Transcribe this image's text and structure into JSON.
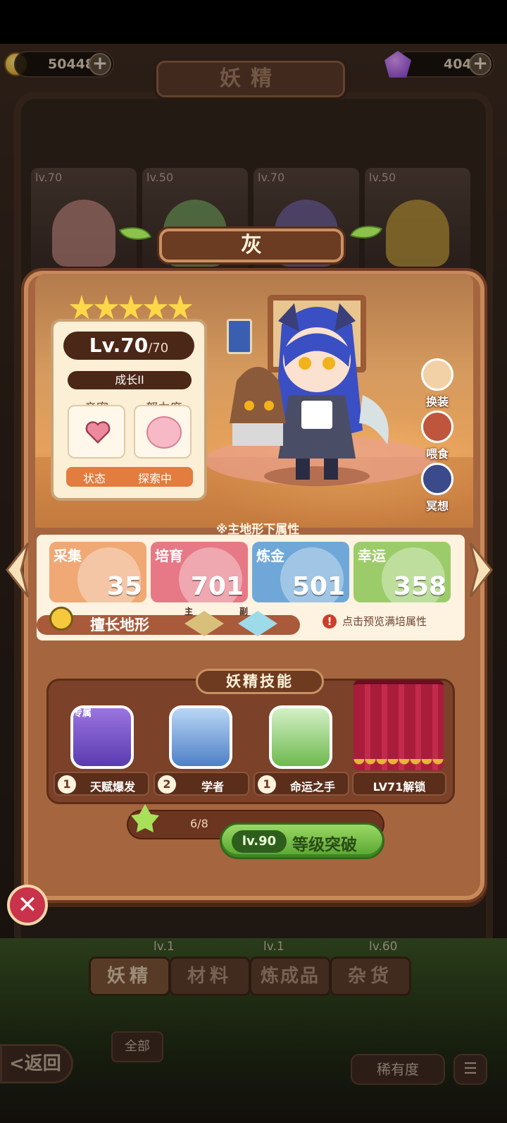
{
  "header": {
    "title": "妖精"
  },
  "currency": {
    "coins": "50448",
    "gems": "404"
  },
  "background_cards": [
    {
      "level": "lv.70"
    },
    {
      "level": "lv.50"
    },
    {
      "level": "lv.70"
    },
    {
      "level": "lv.50"
    }
  ],
  "fairy": {
    "name": "灰",
    "stars": 5,
    "level": "Lv.70",
    "level_max": "/70",
    "growth": "成长II",
    "intimacy_label": "亲密",
    "effort_label": "努力度",
    "state_label": "状态",
    "state_value": "探索中"
  },
  "actions": {
    "change_outfit": "换装",
    "feed": "喂食",
    "meditate": "冥想"
  },
  "attributes": {
    "title": "※主地形下属性",
    "items": [
      {
        "name": "采集",
        "value": "35",
        "color": "#f0a875"
      },
      {
        "name": "培育",
        "value": "701",
        "color": "#e77886"
      },
      {
        "name": "炼金",
        "value": "501",
        "color": "#6fa8d8"
      },
      {
        "name": "幸运",
        "value": "358",
        "color": "#9ccc6a"
      }
    ],
    "terrain_label": "擅长地形",
    "terrain_main": "主",
    "terrain_sub": "副",
    "preview_label": "点击预览满培属性"
  },
  "skills": {
    "title": "妖精技能",
    "exclusive_tag": "专属",
    "items": [
      {
        "level": "1",
        "name": "天赋爆发"
      },
      {
        "level": "2",
        "name": "学者"
      },
      {
        "level": "1",
        "name": "命运之手"
      }
    ],
    "locked_label": "LV71解锁"
  },
  "breakthrough": {
    "count": "6/8",
    "level": "lv.90",
    "label": "等级突破"
  },
  "bottom": {
    "tabs": [
      "妖精",
      "材料",
      "炼成品",
      "杂货"
    ],
    "row_levels": [
      "lv.1",
      "lv.1",
      "lv.60"
    ],
    "back": "<返回",
    "all": "全部",
    "rarity": "稀有度",
    "sort_icon": "☰"
  },
  "colors": {
    "panel": "#a5653f",
    "accent_green": "#56a52f",
    "close": "#c8324b"
  }
}
